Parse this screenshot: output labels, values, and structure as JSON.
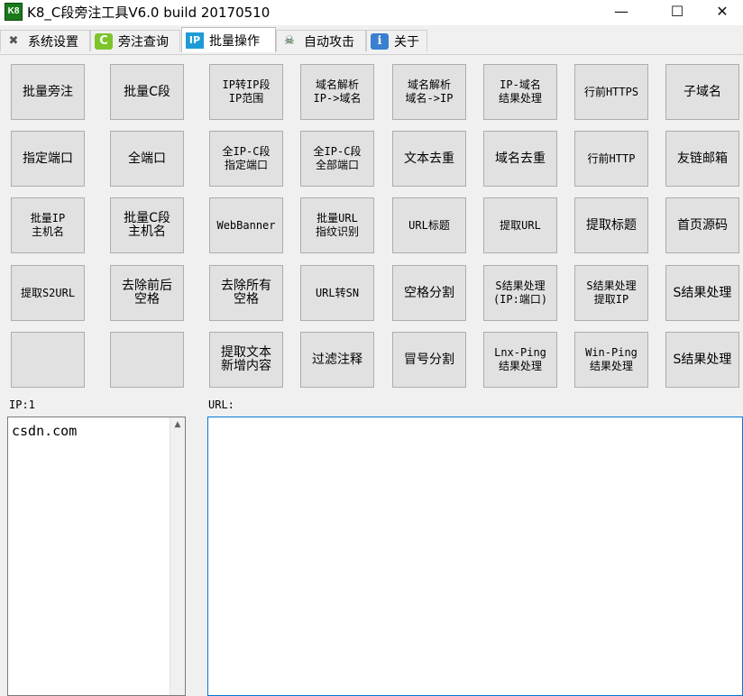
{
  "window": {
    "icon": "K8",
    "title": "K8_C段旁注工具V6.0  build 20170510",
    "minimize": "—",
    "maximize": "☐",
    "close": "✕"
  },
  "tabs": [
    {
      "label": "系统设置",
      "icon": "wrench-icon",
      "glyph": "✖"
    },
    {
      "label": "旁注查询",
      "icon": "c-icon",
      "glyph": "C"
    },
    {
      "label": "批量操作",
      "icon": "ip-icon",
      "glyph": "IP"
    },
    {
      "label": "自动攻击",
      "icon": "hacker-icon",
      "glyph": "☠"
    },
    {
      "label": "关于",
      "icon": "info-icon",
      "glyph": "ℹ"
    }
  ],
  "buttons": [
    [
      "批量旁注",
      "批量C段",
      "IP转IP段\nIP范围",
      "域名解析\nIP->域名",
      "域名解析\n域名->IP",
      "IP-域名\n结果处理",
      "行前HTTPS",
      "子域名"
    ],
    [
      "指定端口",
      "全端口",
      "全IP-C段\n指定端口",
      "全IP-C段\n全部端口",
      "文本去重",
      "域名去重",
      "行前HTTP",
      "友链邮箱"
    ],
    [
      "批量IP\n主机名",
      "批量C段\n主机名",
      "WebBanner",
      "批量URL\n指纹识别",
      "URL标题",
      "提取URL",
      "提取标题",
      "首页源码"
    ],
    [
      "提取S2URL",
      "去除前后\n空格",
      "去除所有\n空格",
      "URL转SN",
      "空格分割",
      "S结果处理\n(IP:端口)",
      "S结果处理\n提取IP",
      "S结果处理"
    ],
    [
      "",
      "",
      "提取文本\n新增内容",
      "过滤注释",
      "冒号分割",
      "Lnx-Ping\n结果处理",
      "Win-Ping\n结果处理",
      "S结果处理"
    ]
  ],
  "ip_panel": {
    "label": "IP:1",
    "value": "csdn.com"
  },
  "url_panel": {
    "label": "URL:",
    "value": ""
  }
}
